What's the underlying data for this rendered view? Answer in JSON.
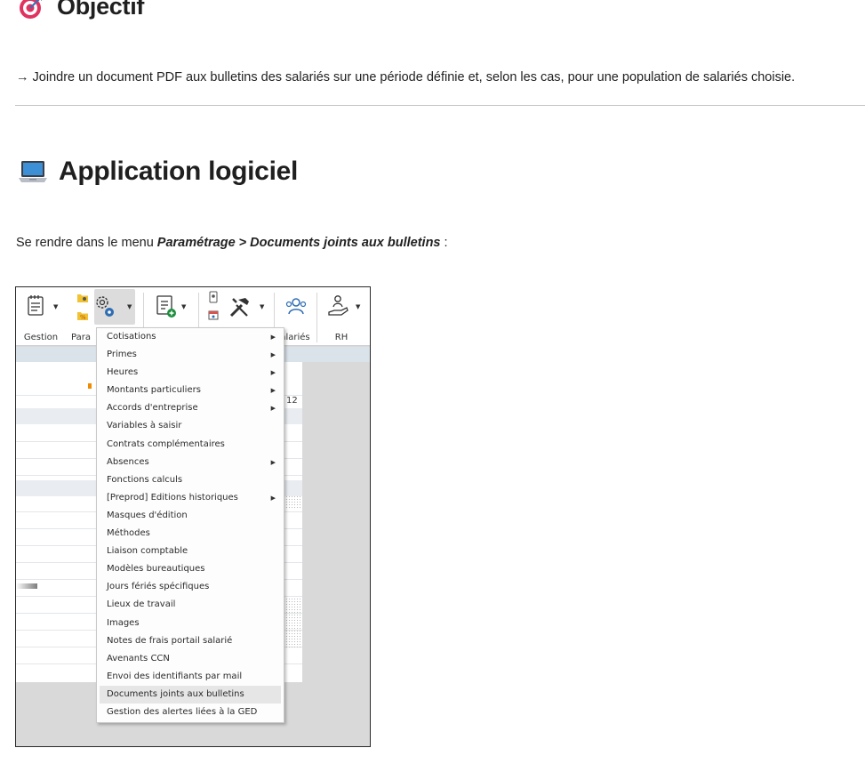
{
  "sections": {
    "objectif": {
      "icon": "target-icon",
      "title": "Objectif",
      "text": "→ Joindre un document PDF aux bulletins des salariés sur une période définie et, selon les cas, pour une population de salariés choisie."
    },
    "application": {
      "icon": "laptop-icon",
      "title": "Application logiciel",
      "intro_prefix": "Se rendre dans le menu ",
      "intro_path": "Paramétrage > Documents joints aux bulletins",
      "intro_suffix": " :"
    }
  },
  "screenshot": {
    "ribbon": {
      "groups": [
        {
          "label": "Gestion",
          "icon": "notepad-list-icon"
        },
        {
          "label": "Para",
          "icon": "settings-gears-icon"
        },
        {
          "label": "",
          "icon": "document-add-icon"
        },
        {
          "label": "",
          "icon": "tools-icon"
        },
        {
          "label": "alariés",
          "icon": "people-icon"
        },
        {
          "label": "RH",
          "icon": "hand-person-icon"
        }
      ]
    },
    "grid_header_value": "12",
    "menu": {
      "items": [
        {
          "label": "Cotisations",
          "submenu": true
        },
        {
          "label": "Primes",
          "submenu": true
        },
        {
          "label": "Heures",
          "submenu": true
        },
        {
          "label": "Montants particuliers",
          "submenu": true
        },
        {
          "label": "Accords d'entreprise",
          "submenu": true
        },
        {
          "label": "Variables à saisir",
          "submenu": false
        },
        {
          "label": "Contrats complémentaires",
          "submenu": false
        },
        {
          "label": "Absences",
          "submenu": true
        },
        {
          "label": "Fonctions calculs",
          "submenu": false
        },
        {
          "label": "[Preprod] Editions historiques",
          "submenu": true
        },
        {
          "label": "Masques d'édition",
          "submenu": false
        },
        {
          "label": "Méthodes",
          "submenu": false
        },
        {
          "label": "Liaison comptable",
          "submenu": false
        },
        {
          "label": "Modèles bureautiques",
          "submenu": false
        },
        {
          "label": "Jours fériés spécifiques",
          "submenu": false
        },
        {
          "label": "Lieux de travail",
          "submenu": false
        },
        {
          "label": "Images",
          "submenu": false
        },
        {
          "label": "Notes de frais portail salarié",
          "submenu": false
        },
        {
          "label": "Avenants CCN",
          "submenu": false
        },
        {
          "label": "Envoi des identifiants par mail",
          "submenu": false
        },
        {
          "label": "Documents joints aux bulletins",
          "submenu": false,
          "highlighted": true
        },
        {
          "label": "Gestion des alertes liées à la GED",
          "submenu": false
        }
      ],
      "highlight_color": "#e6e6e6"
    }
  }
}
